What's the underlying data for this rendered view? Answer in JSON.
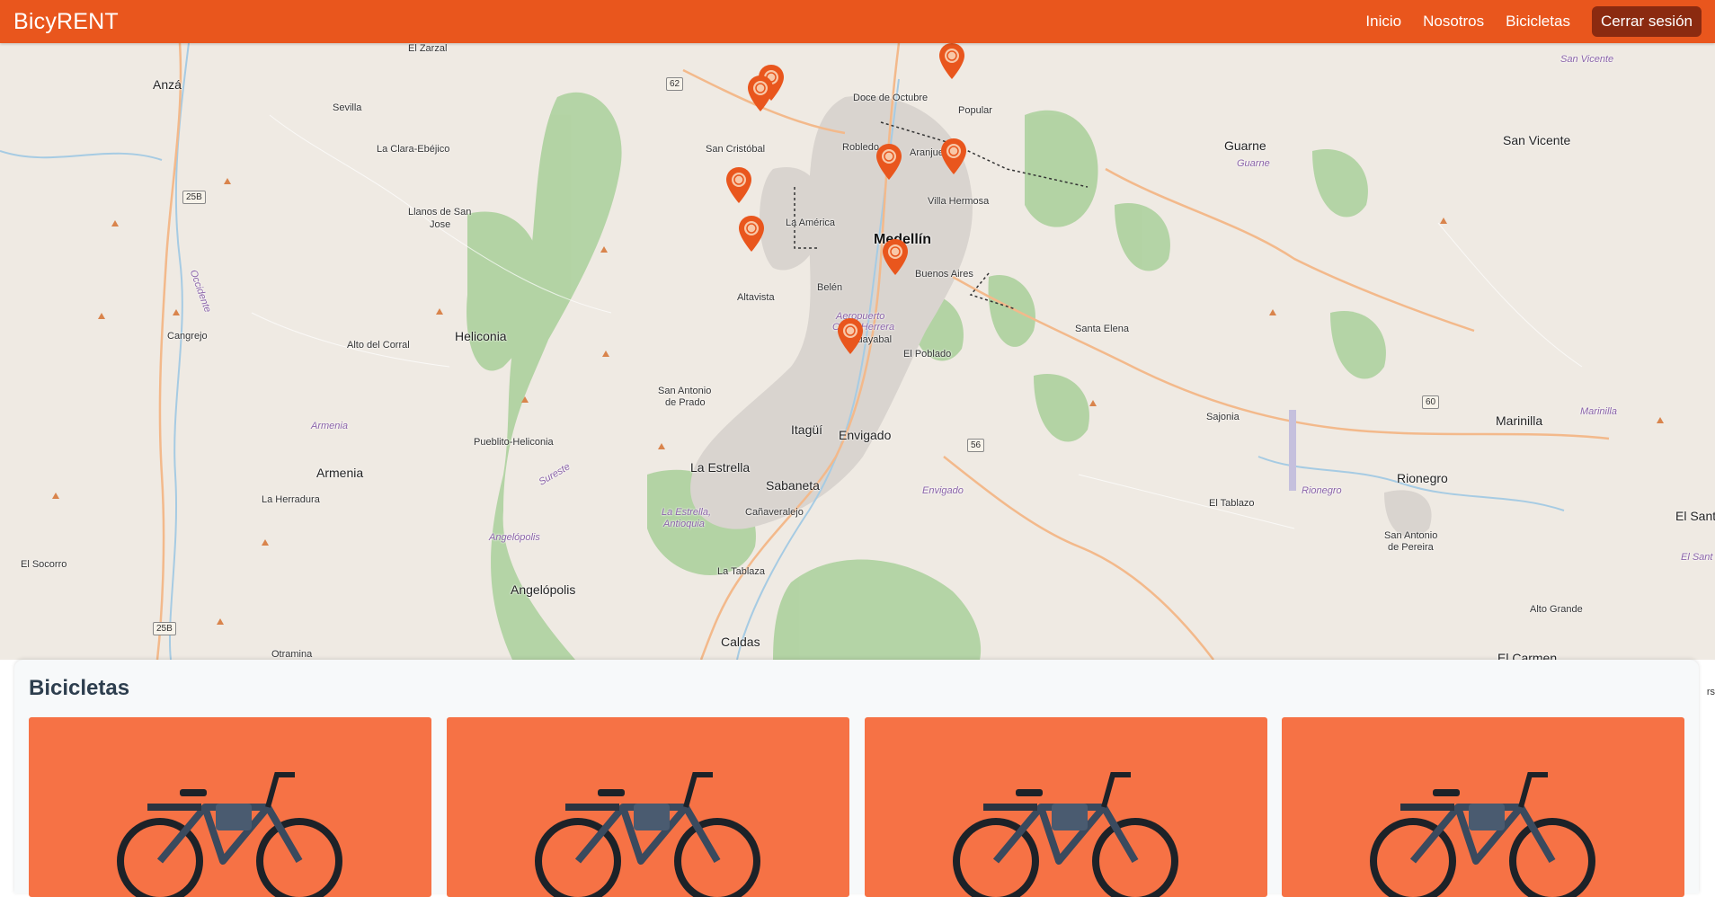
{
  "navbar": {
    "brand": "BicyRENT",
    "links": [
      "Inicio",
      "Nosotros",
      "Bicicletas"
    ],
    "logout_label": "Cerrar sesión"
  },
  "map": {
    "places": {
      "anza": "Anzá",
      "sevilla": "Sevilla",
      "la_clara": "La Clara-Ebéjico",
      "llanos": "Llanos de San",
      "jose": "Jose",
      "cangrejo": "Cangrejo",
      "heliconia": "Heliconia",
      "alto_corral": "Alto del Corral",
      "armenia_river": "Armenia",
      "armenia": "Armenia",
      "pueblito": "Pueblito-Heliconia",
      "la_herradura": "La Herradura",
      "el_socorro": "El Socorro",
      "angelopolis_river": "Angelópolis",
      "angelopolis": "Angelópolis",
      "otramina": "Otramina",
      "san_cristobal": "San Cristóbal",
      "la_america": "La América",
      "altavista": "Altavista",
      "belen": "Belén",
      "san_antonio_prado": "San Antonio",
      "de_prado": "de Prado",
      "la_estrella": "La Estrella",
      "la_estrella_ant": "La Estrella,",
      "antioquia": "Antioquia",
      "sabaneta": "Sabaneta",
      "canaveralejo": "Cañaveralejo",
      "la_tablaza": "La Tablaza",
      "caldas": "Caldas",
      "itagui": "Itagüí",
      "envigado": "Envigado",
      "envigado_river": "Envigado",
      "el_poblado": "El Poblado",
      "guayabal": "Guayabal",
      "medellin": "Medellín",
      "buenos_aires": "Buenos Aires",
      "villa_hermosa": "Villa Hermosa",
      "robledo": "Robledo",
      "aranjuez": "Aranjuez",
      "doce_octubre": "Doce de Octubre",
      "popular": "Popular",
      "guarne": "Guarne",
      "guarne_river": "Guarne",
      "santa_elena": "Santa Elena",
      "sajonia": "Sajonia",
      "el_tablazo": "El Tablazo",
      "rionegro": "Rionegro",
      "rionegro_river": "Rionegro",
      "san_antonio_pereira": "San Antonio",
      "de_pereira": "de Pereira",
      "marinilla": "Marinilla",
      "marinilla_river": "Marinilla",
      "san_vicente": "San Vicente",
      "san_vicente_river": "San Vicente",
      "alto_grande": "Alto Grande",
      "el_carmen": "El Carmen",
      "el_santuario": "El Sant",
      "el_santuario_river": "El Sant",
      "occidente": "Occidente",
      "sureste": "Sureste",
      "aeropuerto": "Aeropuerto",
      "olaya_herrera": "Olaya Herrera",
      "el_zarzal": "El Zarzal"
    },
    "roads": {
      "r62": "62",
      "r25b_a": "25B",
      "r25b_b": "25B",
      "r56": "56",
      "r60": "60"
    },
    "attribution": "rs"
  },
  "panel": {
    "title": "Bicicletas"
  },
  "cards": [
    {
      "name": "bike-card-1"
    },
    {
      "name": "bike-card-2"
    },
    {
      "name": "bike-card-3"
    },
    {
      "name": "bike-card-4"
    }
  ],
  "colors": {
    "primary": "#e9561d",
    "logout": "#8b2a10",
    "card": "#f67245",
    "forest": "#add19e",
    "urban": "#d9d4cf",
    "road": "#f3b98b"
  }
}
